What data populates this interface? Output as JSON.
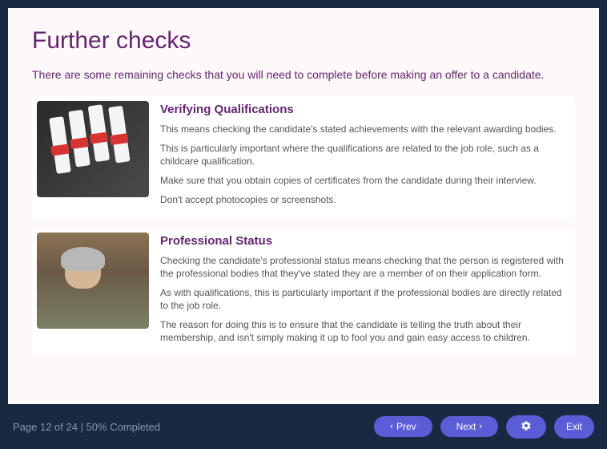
{
  "page": {
    "title": "Further checks",
    "intro": "There are some remaining checks that you will need to complete before making an offer to a candidate."
  },
  "cards": [
    {
      "title": "Verifying Qualifications",
      "paragraphs": [
        "This means checking the candidate's stated achievements with the relevant awarding bodies.",
        "This is particularly important where the qualifications are related to the job role, such as a childcare qualification.",
        "Make sure that you obtain copies of certificates from the candidate during their interview.",
        "Don't accept photocopies or screenshots."
      ]
    },
    {
      "title": "Professional Status",
      "paragraphs": [
        "Checking the candidate's professional status means checking that the person is registered with the professional bodies that they've stated they are a member of on their application form.",
        "As with qualifications, this is particularly important if the professional bodies are directly related to the job role.",
        "The reason for doing this is to ensure that the candidate is telling the truth about their membership, and isn't simply making it up to fool you and gain easy access to children."
      ]
    }
  ],
  "footer": {
    "page_status": "Page 12 of 24 | 50% Completed",
    "prev_label": "Prev",
    "next_label": "Next",
    "exit_label": "Exit"
  }
}
